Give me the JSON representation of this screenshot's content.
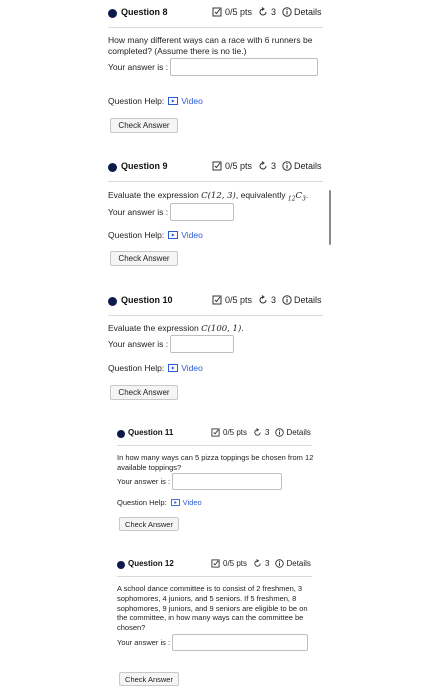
{
  "questions": [
    {
      "title": "Question 8",
      "points": "0/5 pts",
      "retries": "3",
      "details": "Details",
      "prompt": "How many different ways can a race with 6 runners be completed? (Assume there is no tie.)",
      "answer_label": "Your answer is :",
      "help_label": "Question Help:",
      "video_label": "Video",
      "check_label": "Check Answer"
    },
    {
      "title": "Question 9",
      "points": "0/5 pts",
      "retries": "3",
      "details": "Details",
      "prompt_text": "Evaluate the expression",
      "prompt_math": "C(12, 3)",
      "prompt_mid": ", equivalently",
      "prompt_math2_sub": "12",
      "prompt_math2": "C",
      "prompt_math2_sub2": "3",
      "prompt_end": ".",
      "answer_label": "Your answer is :",
      "help_label": "Question Help:",
      "video_label": "Video",
      "check_label": "Check Answer"
    },
    {
      "title": "Question 10",
      "points": "0/5 pts",
      "retries": "3",
      "details": "Details",
      "prompt_text": "Evaluate the expression",
      "prompt_math": "C(100, 1)",
      "prompt_end": ".",
      "answer_label": "Your answer is :",
      "help_label": "Question Help:",
      "video_label": "Video",
      "check_label": "Check Answer"
    },
    {
      "title": "Question 11",
      "points": "0/5 pts",
      "retries": "3",
      "details": "Details",
      "prompt": "In how many ways can 5 pizza toppings be chosen from 12 available toppings?",
      "answer_label": "Your answer is :",
      "help_label": "Question Help:",
      "video_label": "Video",
      "check_label": "Check Answer"
    },
    {
      "title": "Question 12",
      "points": "0/5 pts",
      "retries": "3",
      "details": "Details",
      "prompt": "A school dance committee is to consist of 2 freshmen, 3 sophomores, 4 juniors, and 5 seniors. If 5 freshmen, 8 sophomores, 9 juniors, and 9 seniors are eligible to be on the committee, in how many ways can the committee be chosen?",
      "answer_label": "Your answer is :",
      "check_label": "Check Answer"
    }
  ],
  "colors": {
    "accent": "#0d1b4c",
    "link": "#2a5bd7"
  }
}
